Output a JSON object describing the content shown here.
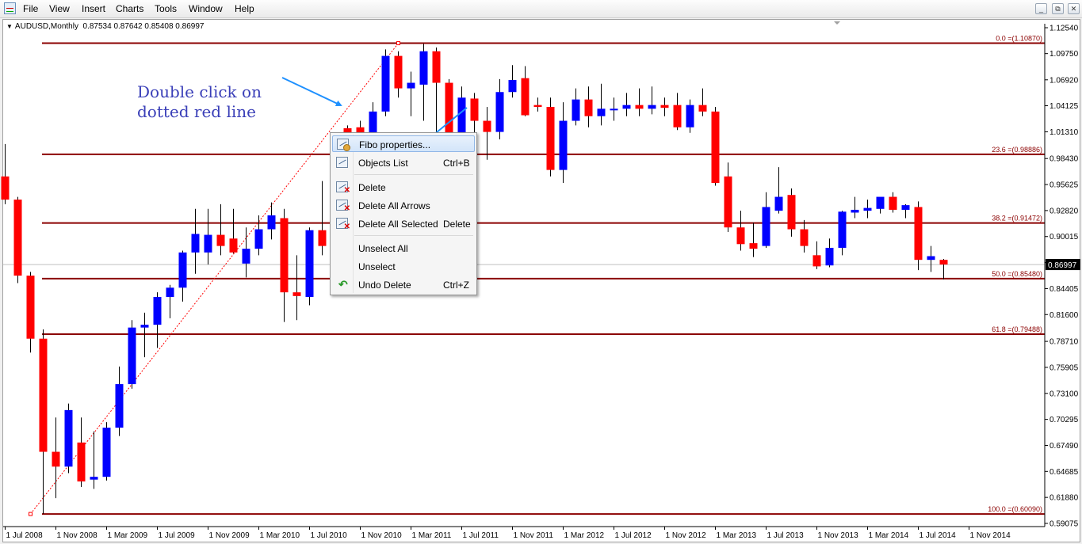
{
  "menu": {
    "items": [
      "File",
      "View",
      "Insert",
      "Charts",
      "Tools",
      "Window",
      "Help"
    ],
    "window_buttons": [
      "minimize-icon",
      "restore-icon",
      "close-icon"
    ]
  },
  "chart_header": {
    "symbol": "AUDUSD,Monthly",
    "ohlc": "0.87534 0.87642 0.85408 0.86997"
  },
  "annotation": {
    "line1": "Double click on",
    "line2": "dotted red line"
  },
  "context_menu": {
    "items": [
      {
        "label": "Fibo properties...",
        "shortcut": "",
        "icon": "fibo-properties-icon",
        "highlighted": true
      },
      {
        "label": "Objects List",
        "shortcut": "Ctrl+B",
        "icon": "objects-list-icon"
      },
      {
        "label": "Delete",
        "shortcut": "",
        "icon": "delete-icon"
      },
      {
        "label": "Delete All Arrows",
        "shortcut": "",
        "icon": "delete-arrows-icon"
      },
      {
        "label": "Delete All Selected",
        "shortcut": "Delete",
        "icon": "delete-selected-icon"
      },
      {
        "label": "Unselect All",
        "shortcut": ""
      },
      {
        "label": "Unselect",
        "shortcut": ""
      },
      {
        "label": "Undo Delete",
        "shortcut": "Ctrl+Z",
        "icon": "undo-icon"
      }
    ]
  },
  "colors": {
    "bull": "#0000ff",
    "bear": "#ff0000",
    "fib_line": "#8b0000",
    "annotation_text": "#3a3fb8",
    "arrow": "#1e90ff"
  },
  "chart_data": {
    "type": "candlestick",
    "symbol": "AUDUSD",
    "timeframe": "Monthly",
    "y_ticks": [
      1.1254,
      1.0975,
      1.0692,
      1.04125,
      1.0131,
      0.9843,
      0.95625,
      0.9282,
      0.90015,
      0.8721,
      0.84405,
      0.816,
      0.7871,
      0.75905,
      0.731,
      0.70295,
      0.6749,
      0.64685,
      0.6188,
      0.59075
    ],
    "y_tick_labels": [
      "1.12540",
      "1.09750",
      "1.06920",
      "1.04125",
      "1.01310",
      "0.98430",
      "0.95625",
      "0.92820",
      "0.90015",
      "0.87210",
      "0.84405",
      "0.81600",
      "0.78710",
      "0.75905",
      "0.73100",
      "0.70295",
      "0.67490",
      "0.64685",
      "0.61880",
      "0.59075"
    ],
    "x_labels": [
      "1 Jul 2008",
      "1 Nov 2008",
      "1 Mar 2009",
      "1 Jul 2009",
      "1 Nov 2009",
      "1 Mar 2010",
      "1 Jul 2010",
      "1 Nov 2010",
      "1 Mar 2011",
      "1 Jul 2011",
      "1 Nov 2011",
      "1 Mar 2012",
      "1 Jul 2012",
      "1 Nov 2012",
      "1 Mar 2013",
      "1 Jul 2013",
      "1 Nov 2013",
      "1 Mar 2014",
      "1 Jul 2014",
      "1 Nov 2014"
    ],
    "current_price": 0.86997,
    "current_price_label": "0.86997",
    "fibo_levels": [
      {
        "level": 0.0,
        "price": 1.1087,
        "label": "0.0 =(1.10870)"
      },
      {
        "level": 23.6,
        "price": 0.98886,
        "label": "23.6 =(0.98886)"
      },
      {
        "level": 38.2,
        "price": 0.91472,
        "label": "38.2 =(0.91472)"
      },
      {
        "level": 50.0,
        "price": 0.8548,
        "label": "50.0 =(0.85480)"
      },
      {
        "level": 61.8,
        "price": 0.79488,
        "label": "61.8 =(0.79488)"
      },
      {
        "level": 100.0,
        "price": 0.6009,
        "label": "100.0 =(0.60090)"
      }
    ],
    "fibo_trendline": {
      "start_price": 0.6009,
      "end_price": 1.1087,
      "start_index": 2,
      "end_index": 31
    },
    "candles": [
      {
        "o": 0.965,
        "h": 1.0,
        "l": 0.935,
        "c": 0.94
      },
      {
        "o": 0.94,
        "h": 0.943,
        "l": 0.85,
        "c": 0.858
      },
      {
        "o": 0.858,
        "h": 0.862,
        "l": 0.775,
        "c": 0.79
      },
      {
        "o": 0.79,
        "h": 0.8,
        "l": 0.601,
        "c": 0.668
      },
      {
        "o": 0.668,
        "h": 0.705,
        "l": 0.618,
        "c": 0.652
      },
      {
        "o": 0.652,
        "h": 0.72,
        "l": 0.645,
        "c": 0.713
      },
      {
        "o": 0.678,
        "h": 0.705,
        "l": 0.63,
        "c": 0.636
      },
      {
        "o": 0.638,
        "h": 0.69,
        "l": 0.628,
        "c": 0.641
      },
      {
        "o": 0.641,
        "h": 0.7,
        "l": 0.637,
        "c": 0.694
      },
      {
        "o": 0.694,
        "h": 0.76,
        "l": 0.685,
        "c": 0.741
      },
      {
        "o": 0.741,
        "h": 0.81,
        "l": 0.736,
        "c": 0.802
      },
      {
        "o": 0.802,
        "h": 0.818,
        "l": 0.77,
        "c": 0.805
      },
      {
        "o": 0.805,
        "h": 0.84,
        "l": 0.78,
        "c": 0.835
      },
      {
        "o": 0.835,
        "h": 0.848,
        "l": 0.812,
        "c": 0.845
      },
      {
        "o": 0.845,
        "h": 0.885,
        "l": 0.83,
        "c": 0.883
      },
      {
        "o": 0.883,
        "h": 0.93,
        "l": 0.86,
        "c": 0.903
      },
      {
        "o": 0.883,
        "h": 0.93,
        "l": 0.87,
        "c": 0.902
      },
      {
        "o": 0.902,
        "h": 0.935,
        "l": 0.88,
        "c": 0.89
      },
      {
        "o": 0.898,
        "h": 0.93,
        "l": 0.882,
        "c": 0.883
      },
      {
        "o": 0.871,
        "h": 0.91,
        "l": 0.856,
        "c": 0.887
      },
      {
        "o": 0.887,
        "h": 0.923,
        "l": 0.88,
        "c": 0.908
      },
      {
        "o": 0.908,
        "h": 0.937,
        "l": 0.897,
        "c": 0.923
      },
      {
        "o": 0.92,
        "h": 0.93,
        "l": 0.808,
        "c": 0.84
      },
      {
        "o": 0.84,
        "h": 0.88,
        "l": 0.81,
        "c": 0.836
      },
      {
        "o": 0.835,
        "h": 0.91,
        "l": 0.826,
        "c": 0.907
      },
      {
        "o": 0.907,
        "h": 0.96,
        "l": 0.88,
        "c": 0.89
      },
      {
        "o": 0.96,
        "h": 0.99,
        "l": 0.94,
        "c": 0.985
      },
      {
        "o": 1.017,
        "h": 1.02,
        "l": 0.99,
        "c": 1.008
      },
      {
        "o": 1.018,
        "h": 1.025,
        "l": 0.995,
        "c": 1.012
      },
      {
        "o": 1.012,
        "h": 1.045,
        "l": 1.005,
        "c": 1.035
      },
      {
        "o": 1.035,
        "h": 1.102,
        "l": 1.03,
        "c": 1.095
      },
      {
        "o": 1.095,
        "h": 1.1,
        "l": 1.05,
        "c": 1.06
      },
      {
        "o": 1.06,
        "h": 1.078,
        "l": 1.03,
        "c": 1.066
      },
      {
        "o": 1.064,
        "h": 1.108,
        "l": 1.025,
        "c": 1.1
      },
      {
        "o": 1.1,
        "h": 1.104,
        "l": 0.985,
        "c": 1.066
      },
      {
        "o": 1.066,
        "h": 1.07,
        "l": 0.96,
        "c": 0.97
      },
      {
        "o": 0.97,
        "h": 1.062,
        "l": 0.937,
        "c": 1.05
      },
      {
        "o": 1.049,
        "h": 1.055,
        "l": 0.965,
        "c": 1.025
      },
      {
        "o": 1.025,
        "h": 1.04,
        "l": 0.983,
        "c": 1.013
      },
      {
        "o": 1.013,
        "h": 1.07,
        "l": 1.005,
        "c": 1.056
      },
      {
        "o": 1.056,
        "h": 1.085,
        "l": 1.05,
        "c": 1.069
      },
      {
        "o": 1.071,
        "h": 1.084,
        "l": 1.03,
        "c": 1.031
      },
      {
        "o": 1.042,
        "h": 1.05,
        "l": 1.035,
        "c": 1.04
      },
      {
        "o": 1.04,
        "h": 1.05,
        "l": 0.965,
        "c": 0.972
      },
      {
        "o": 0.972,
        "h": 1.045,
        "l": 0.958,
        "c": 1.025
      },
      {
        "o": 1.025,
        "h": 1.06,
        "l": 1.02,
        "c": 1.048
      },
      {
        "o": 1.048,
        "h": 1.062,
        "l": 1.018,
        "c": 1.03
      },
      {
        "o": 1.03,
        "h": 1.065,
        "l": 1.02,
        "c": 1.038
      },
      {
        "o": 1.037,
        "h": 1.05,
        "l": 1.025,
        "c": 1.038
      },
      {
        "o": 1.038,
        "h": 1.055,
        "l": 1.03,
        "c": 1.042
      },
      {
        "o": 1.042,
        "h": 1.06,
        "l": 1.03,
        "c": 1.038
      },
      {
        "o": 1.038,
        "h": 1.062,
        "l": 1.032,
        "c": 1.042
      },
      {
        "o": 1.042,
        "h": 1.05,
        "l": 1.03,
        "c": 1.039
      },
      {
        "o": 1.042,
        "h": 1.055,
        "l": 1.015,
        "c": 1.018
      },
      {
        "o": 1.018,
        "h": 1.048,
        "l": 1.012,
        "c": 1.042
      },
      {
        "o": 1.042,
        "h": 1.06,
        "l": 1.03,
        "c": 1.035
      },
      {
        "o": 1.035,
        "h": 1.04,
        "l": 0.955,
        "c": 0.958
      },
      {
        "o": 0.965,
        "h": 0.98,
        "l": 0.905,
        "c": 0.91
      },
      {
        "o": 0.91,
        "h": 0.928,
        "l": 0.885,
        "c": 0.892
      },
      {
        "o": 0.893,
        "h": 0.915,
        "l": 0.878,
        "c": 0.887
      },
      {
        "o": 0.89,
        "h": 0.948,
        "l": 0.888,
        "c": 0.932
      },
      {
        "o": 0.928,
        "h": 0.975,
        "l": 0.925,
        "c": 0.943
      },
      {
        "o": 0.945,
        "h": 0.952,
        "l": 0.9,
        "c": 0.908
      },
      {
        "o": 0.908,
        "h": 0.918,
        "l": 0.883,
        "c": 0.89
      },
      {
        "o": 0.88,
        "h": 0.895,
        "l": 0.865,
        "c": 0.868
      },
      {
        "o": 0.869,
        "h": 0.898,
        "l": 0.867,
        "c": 0.888
      },
      {
        "o": 0.888,
        "h": 0.928,
        "l": 0.88,
        "c": 0.927
      },
      {
        "o": 0.926,
        "h": 0.943,
        "l": 0.92,
        "c": 0.929
      },
      {
        "o": 0.928,
        "h": 0.94,
        "l": 0.92,
        "c": 0.931
      },
      {
        "o": 0.93,
        "h": 0.942,
        "l": 0.925,
        "c": 0.943
      },
      {
        "o": 0.943,
        "h": 0.948,
        "l": 0.926,
        "c": 0.929
      },
      {
        "o": 0.929,
        "h": 0.935,
        "l": 0.92,
        "c": 0.934
      },
      {
        "o": 0.932,
        "h": 0.938,
        "l": 0.864,
        "c": 0.875
      },
      {
        "o": 0.875,
        "h": 0.89,
        "l": 0.862,
        "c": 0.879
      },
      {
        "o": 0.875,
        "h": 0.876,
        "l": 0.854,
        "c": 0.87
      }
    ]
  }
}
